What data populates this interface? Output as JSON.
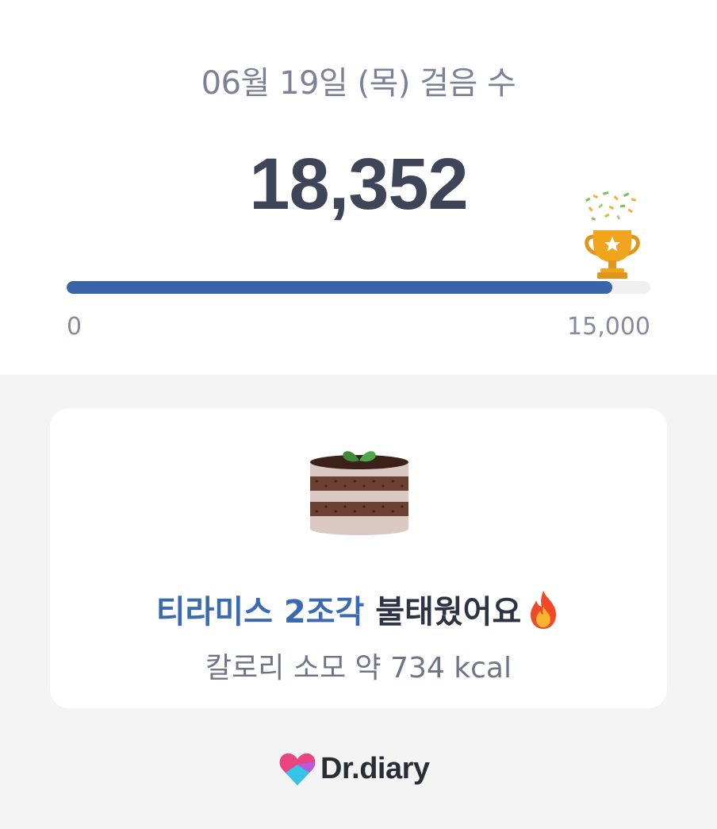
{
  "header": {
    "date_title": "06월 19일 (목) 걸음 수"
  },
  "steps": {
    "count": "18,352",
    "goal_progress": 0.935
  },
  "progress_scale": {
    "min_label": "0",
    "max_label": "15,000"
  },
  "burn_card": {
    "food_highlight": "티라미스 2조각",
    "burn_text": " 불태웠어요",
    "calorie_text": "칼로리 소모 약 734 kcal"
  },
  "brand": {
    "name": "Dr.diary"
  },
  "icons": {
    "trophy": "trophy-icon",
    "confetti": "confetti-icon",
    "cake": "tiramisu-cake-icon",
    "flame": "flame-icon",
    "logo": "drdiary-heart-logo"
  },
  "colors": {
    "accent": "#3a63a8",
    "highlight_text": "#3a6bb0",
    "trophy_gold": "#f0a51c",
    "logo_pink": "#e8457f",
    "logo_cyan": "#33c4e6"
  }
}
